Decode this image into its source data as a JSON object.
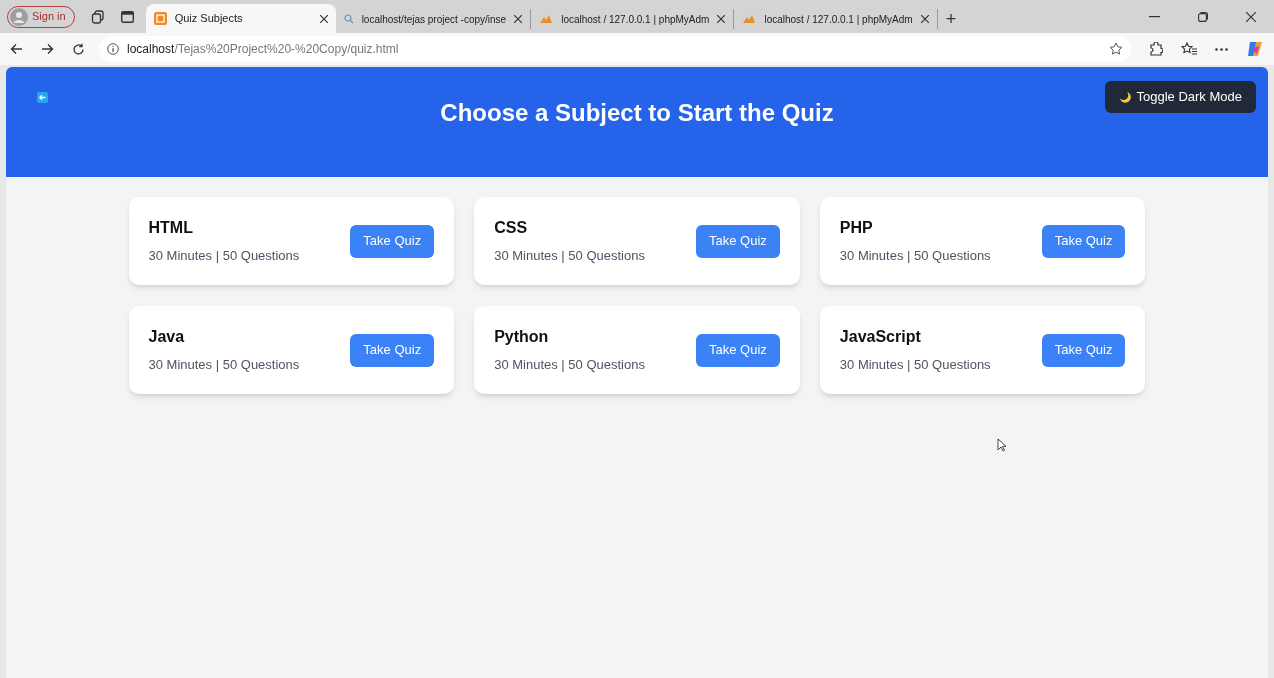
{
  "browser": {
    "sign_in": "Sign in",
    "tabs": [
      {
        "title": "Quiz Subjects",
        "selected": true,
        "kind": "quiz"
      },
      {
        "title": "localhost/tejas project -copy/inse",
        "selected": false,
        "kind": "search"
      },
      {
        "title": "localhost / 127.0.0.1 | phpMyAdm",
        "selected": false,
        "kind": "pma"
      },
      {
        "title": "localhost / 127.0.0.1 | phpMyAdm",
        "selected": false,
        "kind": "pma"
      }
    ],
    "new_tab": "+",
    "address": {
      "host": "localhost",
      "path": "/Tejas%20Project%20-%20Copy/quiz.html"
    }
  },
  "header": {
    "title": "Choose a Subject to Start the Quiz",
    "toggle_button": "Toggle Dark Mode"
  },
  "subjects": [
    {
      "name": "HTML",
      "details": "30 Minutes | 50 Questions",
      "button": "Take Quiz"
    },
    {
      "name": "CSS",
      "details": "30 Minutes | 50 Questions",
      "button": "Take Quiz"
    },
    {
      "name": "PHP",
      "details": "30 Minutes | 50 Questions",
      "button": "Take Quiz"
    },
    {
      "name": "Java",
      "details": "30 Minutes | 50 Questions",
      "button": "Take Quiz"
    },
    {
      "name": "Python",
      "details": "30 Minutes | 50 Questions",
      "button": "Take Quiz"
    },
    {
      "name": "JavaScript",
      "details": "30 Minutes | 50 Questions",
      "button": "Take Quiz"
    }
  ]
}
